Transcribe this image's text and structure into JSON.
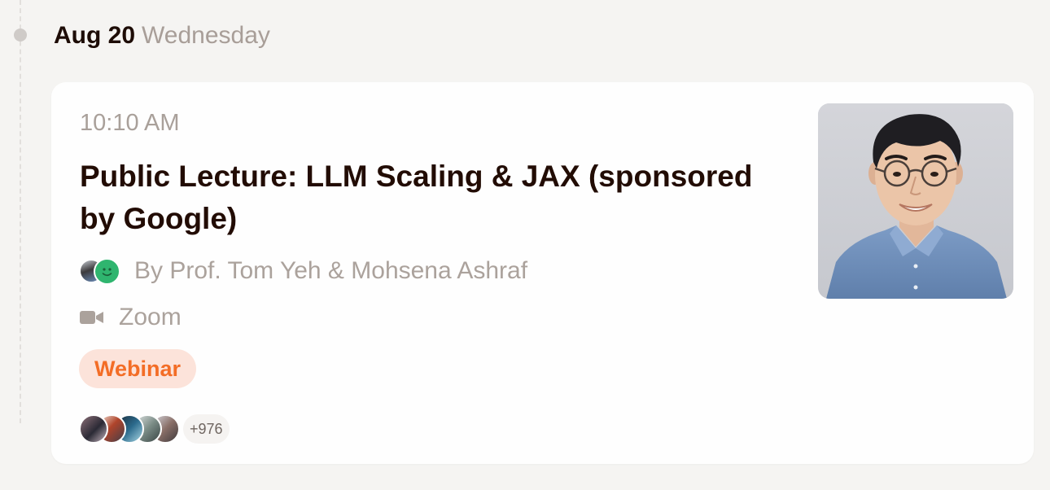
{
  "date": {
    "main": "Aug 20",
    "weekday": "Wednesday"
  },
  "event": {
    "time": "10:10 AM",
    "title": "Public Lecture: LLM Scaling & JAX (sponsored by Google)",
    "hosts_text": "By Prof. Tom Yeh & Mohsena Ashraf",
    "location": "Zoom",
    "tag": "Webinar",
    "attendee_count_label": "+976"
  },
  "colors": {
    "background": "#f5f4f2",
    "card": "#fefefe",
    "title_text": "#220c04",
    "muted_text": "#aba29c",
    "tag_bg": "#fce3da",
    "tag_text": "#f36d26",
    "host_avatar_green": "#2fb56f"
  },
  "icons": {
    "location": "video-camera-icon",
    "timeline": "timeline-dot"
  }
}
